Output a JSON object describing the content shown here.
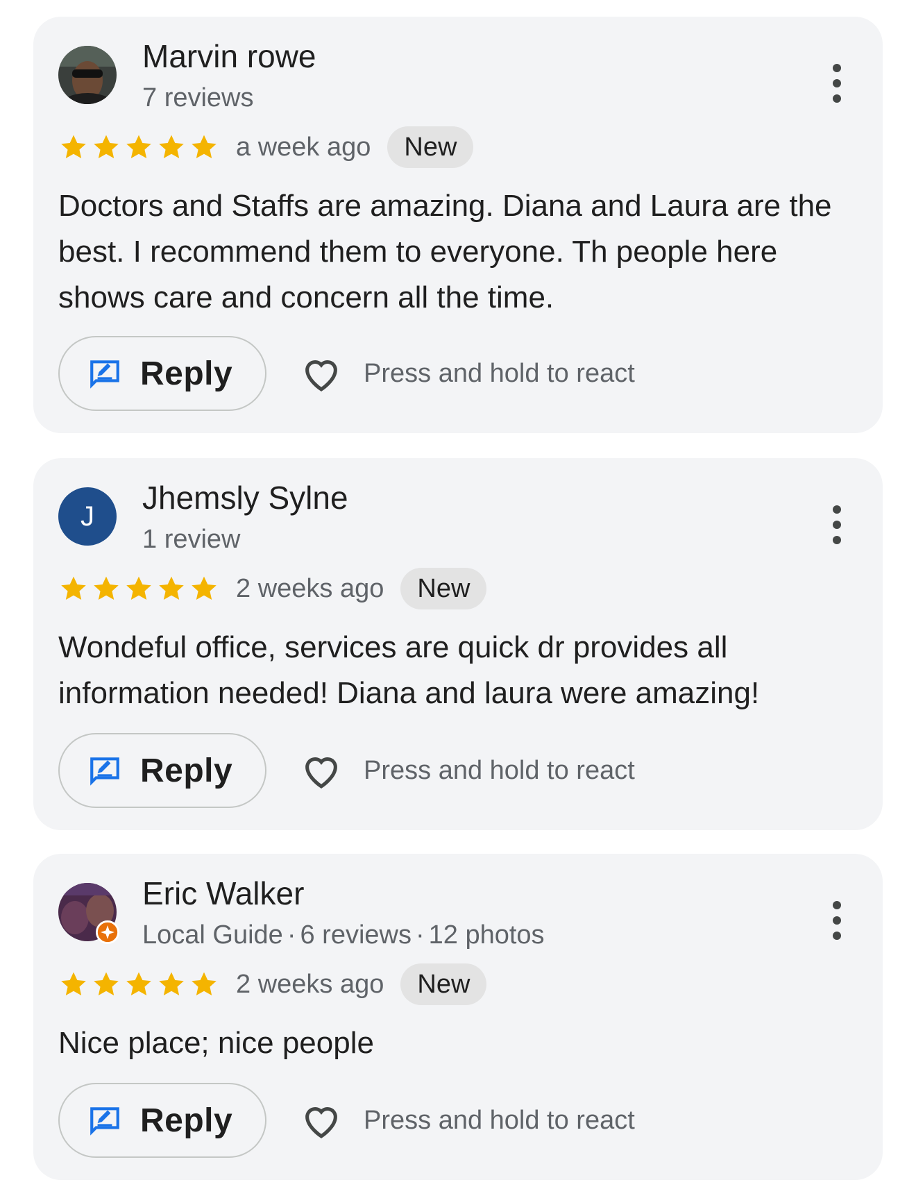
{
  "colors": {
    "star": "#f4b400",
    "reply_icon": "#1a73e8",
    "local_guide_badge": "#e8710a",
    "letter_avatar_bg": "#1f4e8c"
  },
  "reviews": [
    {
      "author": "Marvin rowe",
      "meta": "7 reviews",
      "rating": 5,
      "time": "a week ago",
      "badge": "New",
      "text": "Doctors and Staffs are amazing. Diana and Laura are the best. I recommend them to everyone. Th people here shows care and concern all the time.",
      "reply_label": "Reply",
      "react_label": "Press and hold to react",
      "avatar": "photo"
    },
    {
      "author": "Jhemsly Sylne",
      "meta": "1 review",
      "rating": 5,
      "time": "2 weeks ago",
      "badge": "New",
      "text": "Wondeful office, services are quick dr provides all information needed! Diana and laura were amazing!",
      "reply_label": "Reply",
      "react_label": "Press and hold to react",
      "avatar": "letter",
      "avatar_letter": "J"
    },
    {
      "author": "Eric Walker",
      "meta_parts": [
        "Local Guide",
        "6 reviews",
        "12 photos"
      ],
      "meta_sep": "·",
      "rating": 5,
      "time": "2 weeks ago",
      "badge": "New",
      "text": "Nice place; nice people",
      "reply_label": "Reply",
      "react_label": "Press and hold to react",
      "avatar": "photo-local-guide"
    }
  ]
}
